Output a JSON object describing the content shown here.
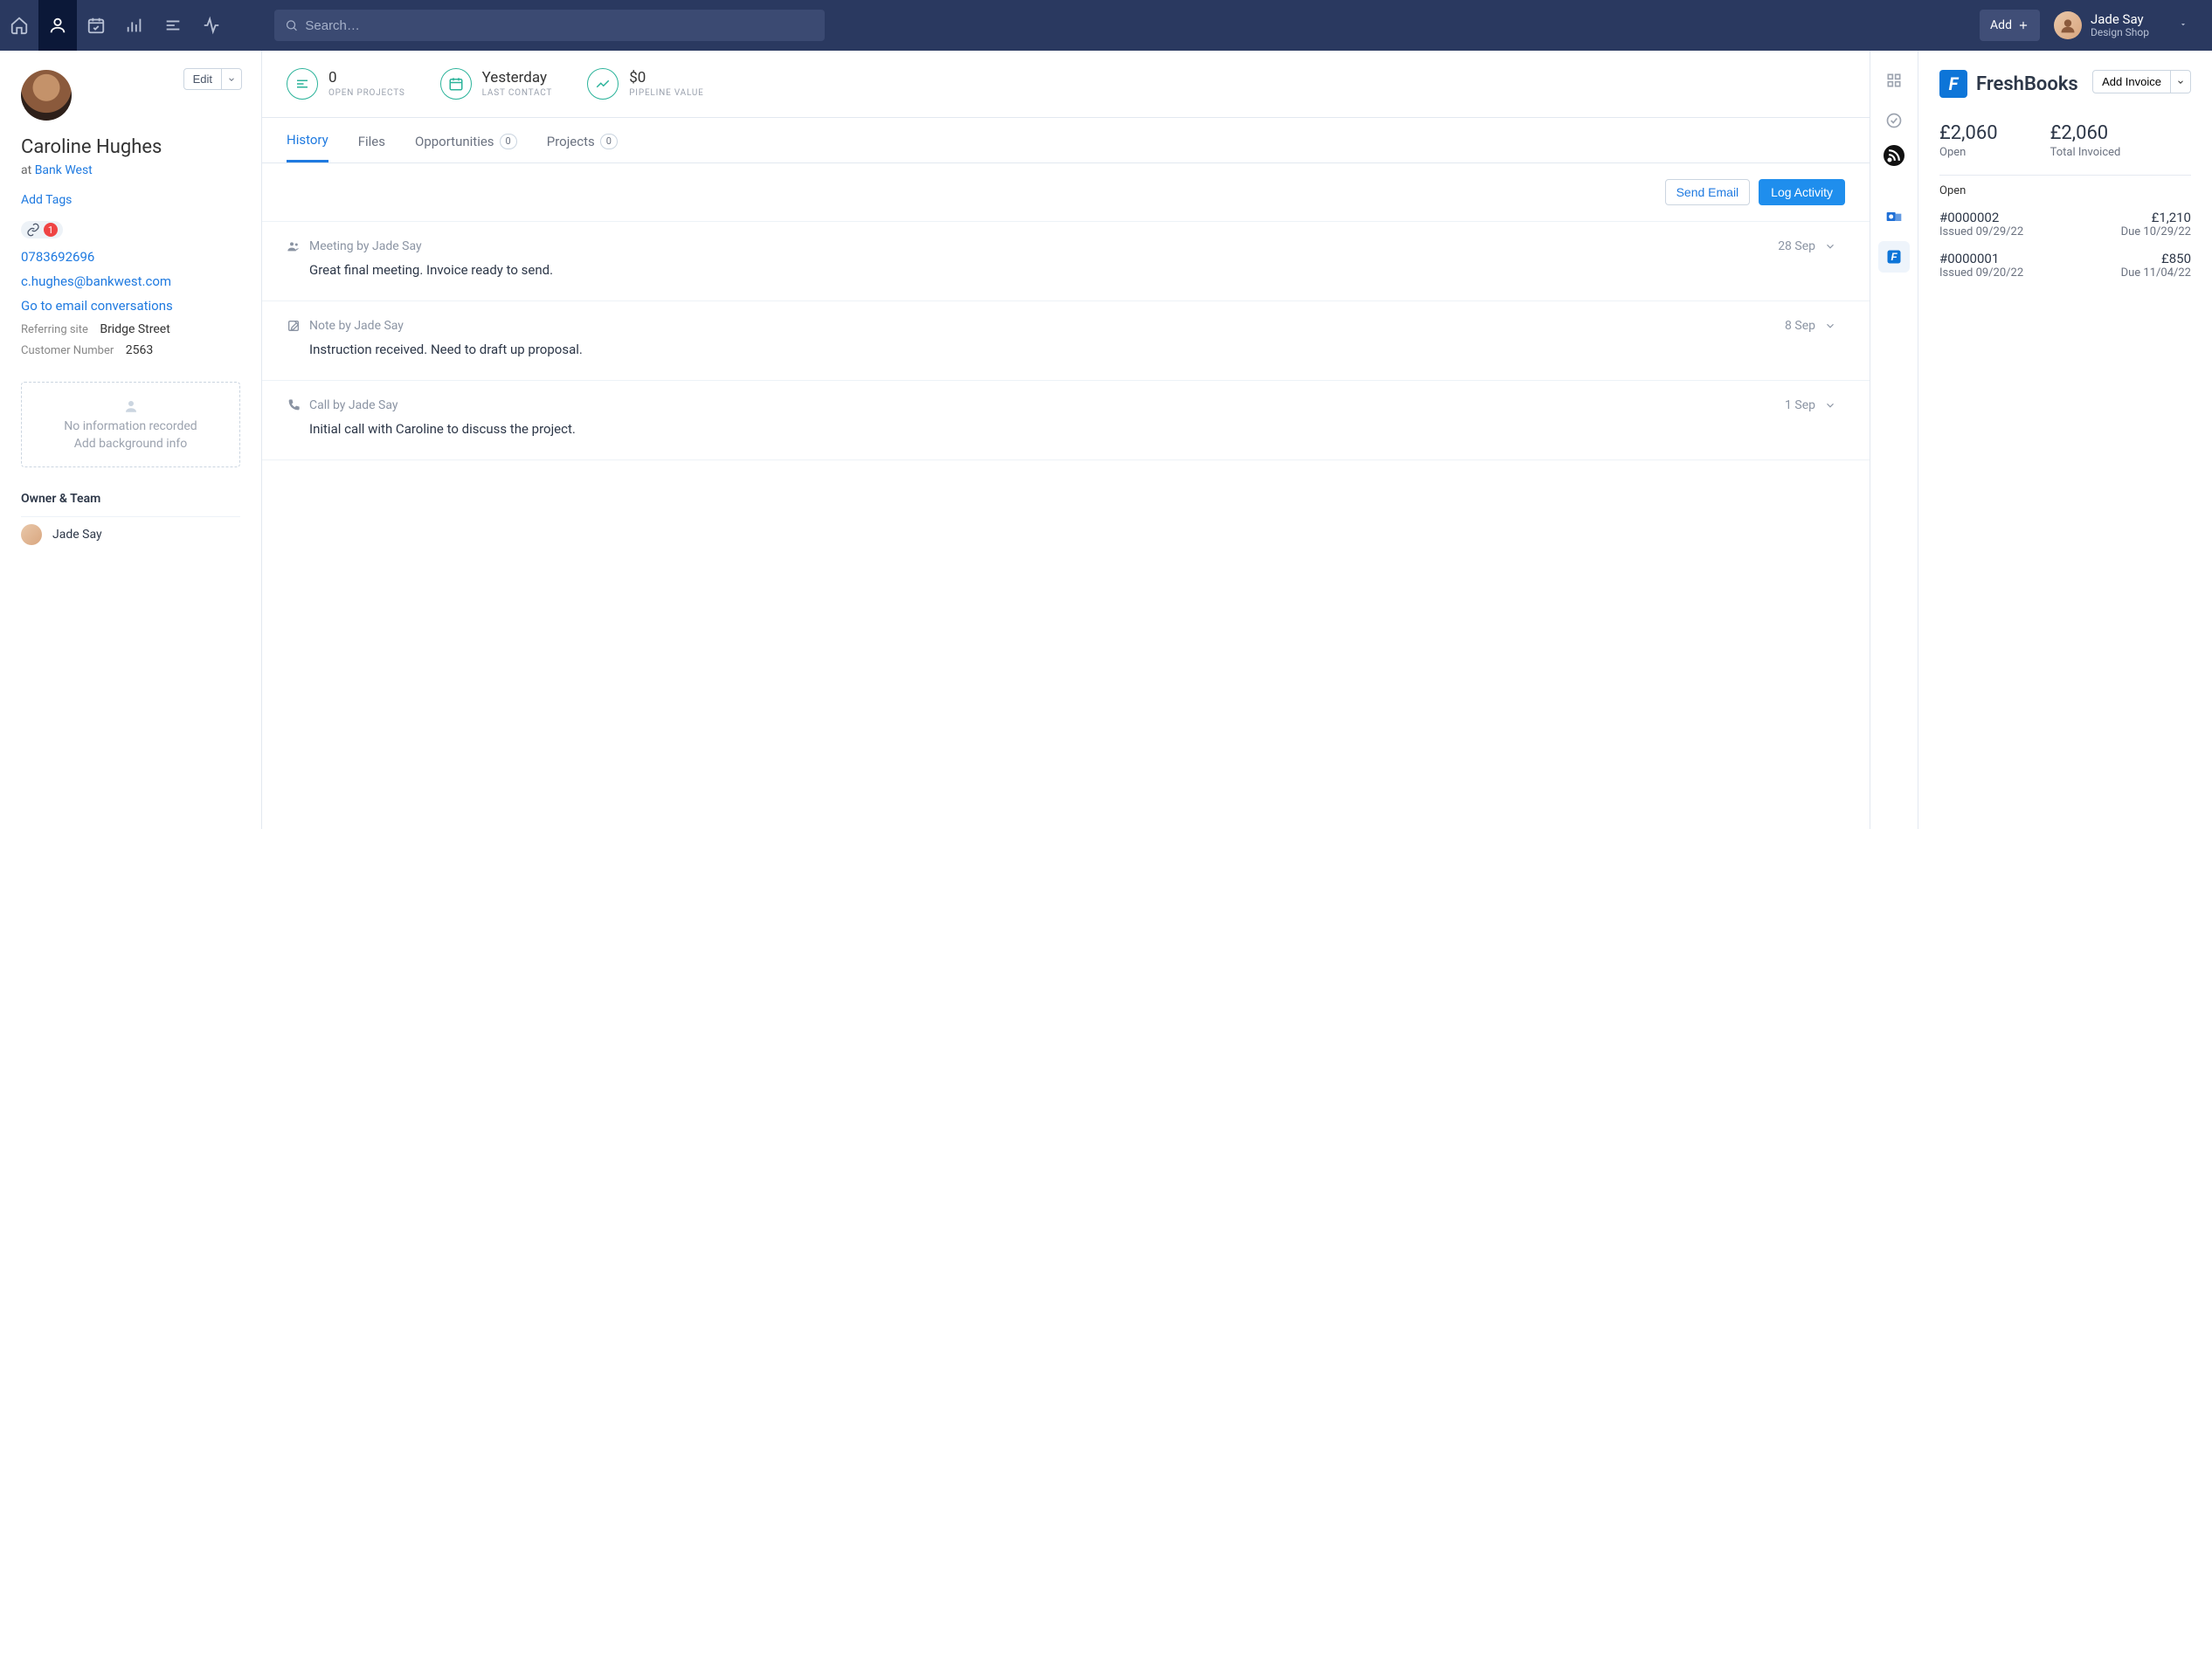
{
  "topnav": {
    "search_placeholder": "Search…",
    "add_label": "Add",
    "user_name": "Jade Say",
    "user_shop": "Design Shop"
  },
  "left": {
    "edit_label": "Edit",
    "contact_name": "Caroline Hughes",
    "at_prefix": "at",
    "company": "Bank West",
    "add_tags": "Add Tags",
    "link_count": "1",
    "phone": "0783692696",
    "email": "c.hughes@bankwest.com",
    "email_conv": "Go to email conversations",
    "referring_site_label": "Referring site",
    "referring_site_value": "Bridge Street",
    "customer_number_label": "Customer Number",
    "customer_number_value": "2563",
    "bg_line1": "No information recorded",
    "bg_line2": "Add background info",
    "owner_team_label": "Owner & Team",
    "owner_name": "Jade Say"
  },
  "kpi": {
    "open_projects_value": "0",
    "open_projects_label": "Open Projects",
    "last_contact_value": "Yesterday",
    "last_contact_label": "Last Contact",
    "pipeline_value": "$0",
    "pipeline_label": "Pipeline Value"
  },
  "tabs": {
    "history": "History",
    "files": "Files",
    "opportunities": "Opportunities",
    "opportunities_count": "0",
    "projects": "Projects",
    "projects_count": "0"
  },
  "actions": {
    "send_email": "Send Email",
    "log_activity": "Log Activity"
  },
  "activities": [
    {
      "label": "Meeting by Jade Say",
      "date": "28 Sep",
      "body": "Great final meeting. Invoice ready to send."
    },
    {
      "label": "Note by Jade Say",
      "date": "8 Sep",
      "body": "Instruction received. Need to draft up proposal."
    },
    {
      "label": "Call by Jade Say",
      "date": "1 Sep",
      "body": "Initial call with Caroline to discuss the project."
    }
  ],
  "freshbooks": {
    "brand": "FreshBooks",
    "add_invoice": "Add Invoice",
    "open_amount": "£2,060",
    "open_label": "Open",
    "total_amount": "£2,060",
    "total_label": "Total Invoiced",
    "section_label": "Open",
    "invoices": [
      {
        "num": "#0000002",
        "issued": "Issued 09/29/22",
        "amt": "£1,210",
        "due": "Due 10/29/22"
      },
      {
        "num": "#0000001",
        "issued": "Issued 09/20/22",
        "amt": "£850",
        "due": "Due 11/04/22"
      }
    ]
  }
}
